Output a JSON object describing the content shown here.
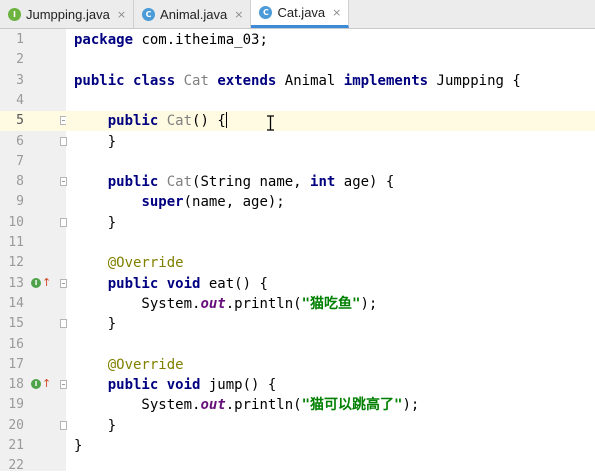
{
  "tabs": [
    {
      "label": "Jumpping.java",
      "icon": "interface-icon",
      "glyph": "I",
      "active": false
    },
    {
      "label": "Animal.java",
      "icon": "class-icon",
      "glyph": "C",
      "active": false
    },
    {
      "label": "Cat.java",
      "icon": "class-icon",
      "glyph": "C",
      "active": true
    }
  ],
  "close_glyph": "×",
  "lines": [
    {
      "n": "1",
      "tokens": [
        [
          "kw",
          "package"
        ],
        [
          "plain",
          " com.itheima_03;"
        ]
      ]
    },
    {
      "n": "2",
      "tokens": []
    },
    {
      "n": "3",
      "tokens": [
        [
          "kw",
          "public"
        ],
        [
          "plain",
          " "
        ],
        [
          "kw",
          "class"
        ],
        [
          "plain",
          " "
        ],
        [
          "type",
          "Cat"
        ],
        [
          "plain",
          " "
        ],
        [
          "kw",
          "extends"
        ],
        [
          "plain",
          " Animal "
        ],
        [
          "kw",
          "implements"
        ],
        [
          "plain",
          " Jumpping {"
        ]
      ]
    },
    {
      "n": "4",
      "tokens": []
    },
    {
      "n": "5",
      "current": true,
      "fold": "open",
      "tokens": [
        [
          "plain",
          "    "
        ],
        [
          "kw",
          "public"
        ],
        [
          "plain",
          " "
        ],
        [
          "type",
          "Cat"
        ],
        [
          "plain",
          "() {"
        ],
        [
          "caret",
          ""
        ]
      ]
    },
    {
      "n": "6",
      "fold": "close",
      "tokens": [
        [
          "plain",
          "    }"
        ]
      ]
    },
    {
      "n": "7",
      "tokens": []
    },
    {
      "n": "8",
      "fold": "open",
      "tokens": [
        [
          "plain",
          "    "
        ],
        [
          "kw",
          "public"
        ],
        [
          "plain",
          " "
        ],
        [
          "type",
          "Cat"
        ],
        [
          "plain",
          "(String name, "
        ],
        [
          "kw",
          "int"
        ],
        [
          "plain",
          " age) {"
        ]
      ]
    },
    {
      "n": "9",
      "tokens": [
        [
          "plain",
          "        "
        ],
        [
          "kw",
          "super"
        ],
        [
          "plain",
          "(name, age);"
        ]
      ]
    },
    {
      "n": "10",
      "fold": "close",
      "tokens": [
        [
          "plain",
          "    }"
        ]
      ]
    },
    {
      "n": "11",
      "tokens": []
    },
    {
      "n": "12",
      "tokens": [
        [
          "plain",
          "    "
        ],
        [
          "ann",
          "@Override"
        ]
      ]
    },
    {
      "n": "13",
      "marker": true,
      "fold": "open",
      "tokens": [
        [
          "plain",
          "    "
        ],
        [
          "kw",
          "public"
        ],
        [
          "plain",
          " "
        ],
        [
          "kw",
          "void"
        ],
        [
          "plain",
          " eat() {"
        ]
      ]
    },
    {
      "n": "14",
      "tokens": [
        [
          "plain",
          "        System."
        ],
        [
          "static",
          "out"
        ],
        [
          "plain",
          ".println("
        ],
        [
          "str",
          "\"猫吃鱼\""
        ],
        [
          "plain",
          ");"
        ]
      ]
    },
    {
      "n": "15",
      "fold": "close",
      "tokens": [
        [
          "plain",
          "    }"
        ]
      ]
    },
    {
      "n": "16",
      "tokens": []
    },
    {
      "n": "17",
      "tokens": [
        [
          "plain",
          "    "
        ],
        [
          "ann",
          "@Override"
        ]
      ]
    },
    {
      "n": "18",
      "marker": true,
      "fold": "open",
      "tokens": [
        [
          "plain",
          "    "
        ],
        [
          "kw",
          "public"
        ],
        [
          "plain",
          " "
        ],
        [
          "kw",
          "void"
        ],
        [
          "plain",
          " jump() {"
        ]
      ]
    },
    {
      "n": "19",
      "tokens": [
        [
          "plain",
          "        System."
        ],
        [
          "static",
          "out"
        ],
        [
          "plain",
          ".println("
        ],
        [
          "str",
          "\"猫可以跳高了\""
        ],
        [
          "plain",
          ");"
        ]
      ]
    },
    {
      "n": "20",
      "fold": "close",
      "tokens": [
        [
          "plain",
          "    }"
        ]
      ]
    },
    {
      "n": "21",
      "tokens": [
        [
          "plain",
          "}"
        ]
      ]
    },
    {
      "n": "22",
      "tokens": []
    }
  ],
  "colors": {
    "keyword": "#000080",
    "annotation": "#808000",
    "string": "#008000",
    "static_field": "#660e7a",
    "class_name": "#808080",
    "current_line": "#fffbe2",
    "active_tab_underline": "#3d8ad8"
  }
}
